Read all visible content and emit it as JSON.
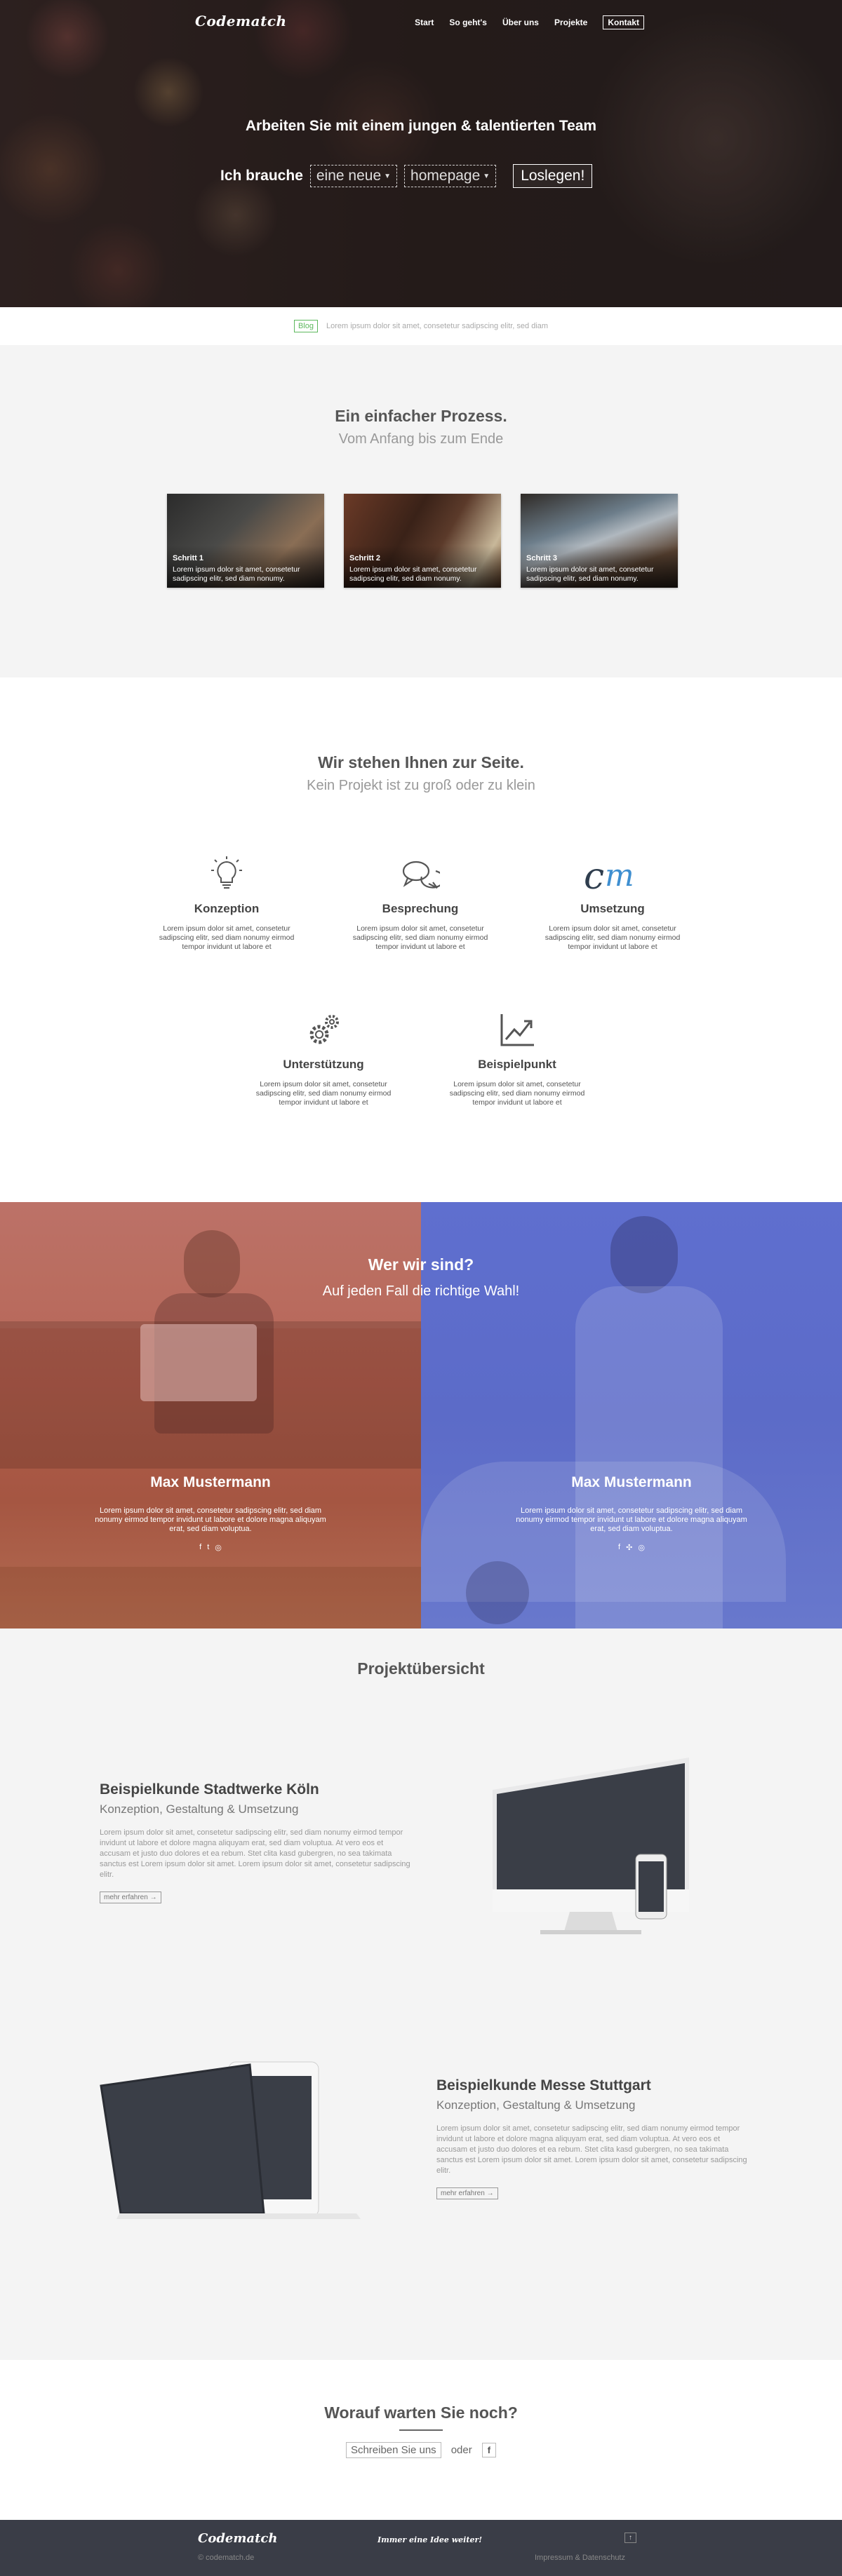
{
  "hero": {
    "logo": "Codematch",
    "nav": [
      "Start",
      "So geht's",
      "Über uns",
      "Projekte",
      "Kontakt"
    ],
    "title": "Arbeiten Sie mit einem jungen & talentierten Team",
    "label": "Ich brauche",
    "select1": "eine neue",
    "select2": "homepage",
    "button": "Loslegen!"
  },
  "blog": {
    "badge": "Blog",
    "text": "Lorem ipsum dolor sit amet, consetetur sadipscing elitr, sed diam"
  },
  "process": {
    "title": "Ein einfacher Prozess.",
    "subtitle": "Vom Anfang bis zum Ende",
    "cards": [
      {
        "title": "Schritt 1",
        "text": "Lorem ipsum dolor sit amet, consetetur sadipscing elitr, sed diam nonumy."
      },
      {
        "title": "Schritt 2",
        "text": "Lorem ipsum dolor sit amet, consetetur sadipscing elitr, sed diam nonumy."
      },
      {
        "title": "Schritt 3",
        "text": "Lorem ipsum dolor sit amet, consetetur sadipscing elitr, sed diam nonumy."
      }
    ]
  },
  "services": {
    "title": "Wir stehen Ihnen zur Seite.",
    "subtitle": "Kein Projekt ist zu groß oder zu klein",
    "items": [
      {
        "title": "Konzeption",
        "icon": "lightbulb-icon",
        "text": "Lorem ipsum dolor sit amet, consetetur sadipscing elitr, sed diam nonumy eirmod tempor invidunt ut labore et"
      },
      {
        "title": "Besprechung",
        "icon": "chat-bubbles-icon",
        "text": "Lorem ipsum dolor sit amet, consetetur sadipscing elitr, sed diam nonumy eirmod tempor invidunt ut labore et"
      },
      {
        "title": "Umsetzung",
        "icon": "cm-logo-icon",
        "text": "Lorem ipsum dolor sit amet, consetetur sadipscing elitr, sed diam nonumy eirmod tempor invidunt ut labore et"
      },
      {
        "title": "Unterstützung",
        "icon": "gears-icon",
        "text": "Lorem ipsum dolor sit amet, consetetur sadipscing elitr, sed diam nonumy eirmod tempor invidunt ut labore et"
      },
      {
        "title": "Beispielpunkt",
        "icon": "chart-up-icon",
        "text": "Lorem ipsum dolor sit amet, consetetur sadipscing elitr, sed diam nonumy eirmod tempor invidunt ut labore et"
      }
    ]
  },
  "team": {
    "title": "Wer wir sind?",
    "subtitle": "Auf jeden Fall die richtige Wahl!",
    "members": [
      {
        "name": "Max Mustermann",
        "text": "Lorem ipsum dolor sit amet, consetetur sadipscing elitr, sed diam nonumy eirmod tempor invidunt ut labore et dolore magna aliquyam erat, sed diam voluptua.",
        "social": [
          "f",
          "t",
          "◎"
        ]
      },
      {
        "name": "Max Mustermann",
        "text": "Lorem ipsum dolor sit amet, consetetur sadipscing elitr, sed diam nonumy eirmod tempor invidunt ut labore et dolore magna aliquyam erat, sed diam voluptua.",
        "social": [
          "f",
          "✣",
          "◎"
        ]
      }
    ]
  },
  "projects": {
    "title": "Projektübersicht",
    "items": [
      {
        "title": "Beispielkunde Stadtwerke Köln",
        "subtitle": "Konzeption, Gestaltung & Umsetzung",
        "text": "Lorem ipsum dolor sit amet, consetetur sadipscing elitr, sed diam nonumy eirmod tempor invidunt ut labore et dolore magna aliquyam erat, sed diam voluptua. At vero eos et accusam et justo duo dolores et ea rebum. Stet clita kasd gubergren, no sea takimata sanctus est Lorem ipsum dolor sit amet. Lorem ipsum dolor sit amet, consetetur sadipscing elitr.",
        "more": "mehr erfahren →"
      },
      {
        "title": "Beispielkunde Messe Stuttgart",
        "subtitle": "Konzeption, Gestaltung & Umsetzung",
        "text": "Lorem ipsum dolor sit amet, consetetur sadipscing elitr, sed diam nonumy eirmod tempor invidunt ut labore et dolore magna aliquyam erat, sed diam voluptua. At vero eos et accusam et justo duo dolores et ea rebum. Stet clita kasd gubergren, no sea takimata sanctus est Lorem ipsum dolor sit amet. Lorem ipsum dolor sit amet, consetetur sadipscing elitr.",
        "more": "mehr erfahren →"
      }
    ]
  },
  "cta": {
    "title": "Worauf warten Sie noch?",
    "button": "Schreiben Sie uns",
    "or": "oder",
    "facebook": "f"
  },
  "footer": {
    "logo": "Codematch",
    "copyright": "© codematch.de",
    "tagline": "Immer eine Idee weiter!",
    "up": "↑",
    "links": "Impressum & Datenschutz"
  }
}
